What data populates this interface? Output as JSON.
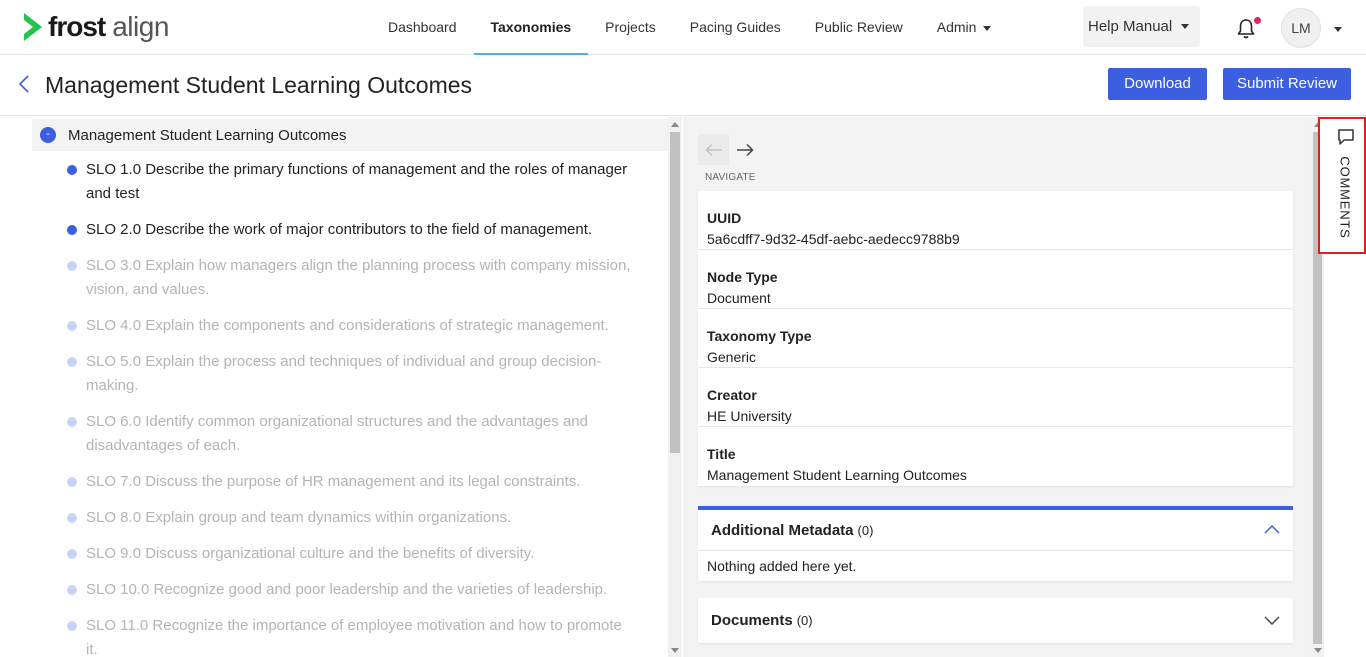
{
  "brand": {
    "word1": "frost",
    "word2": "align",
    "accent_color": "#24c34f"
  },
  "nav": {
    "items": [
      {
        "label": "Dashboard",
        "active": false
      },
      {
        "label": "Taxonomies",
        "active": true
      },
      {
        "label": "Projects",
        "active": false
      },
      {
        "label": "Pacing Guides",
        "active": false
      },
      {
        "label": "Public Review",
        "active": false
      },
      {
        "label": "Admin",
        "active": false,
        "dropdown": true
      }
    ]
  },
  "header": {
    "help_label": "Help Manual",
    "notification_icon": "bell-icon",
    "avatar_initials": "LM"
  },
  "page": {
    "title": "Management Student Learning Outcomes",
    "download_label": "Download",
    "submit_label": "Submit Review"
  },
  "tree": {
    "root_label": "Management Student Learning Outcomes",
    "collapse_symbol": "-",
    "items": [
      {
        "text": "SLO 1.0 Describe the primary functions of management and the roles of manager and test",
        "dim": false
      },
      {
        "text": "SLO 2.0 Describe the work of major contributors to the field of management.",
        "dim": false
      },
      {
        "text": "SLO 3.0 Explain how managers align the planning process with company mission, vision, and values.",
        "dim": true
      },
      {
        "text": "SLO 4.0 Explain the components and considerations of strategic management.",
        "dim": true
      },
      {
        "text": "SLO 5.0 Explain the process and techniques of individual and group decision-making.",
        "dim": true
      },
      {
        "text": "SLO 6.0 Identify common organizational structures and the advantages and disadvantages of each.",
        "dim": true
      },
      {
        "text": "SLO 7.0 Discuss the purpose of HR management and its legal constraints.",
        "dim": true
      },
      {
        "text": "SLO 8.0 Explain group and team dynamics within organizations.",
        "dim": true
      },
      {
        "text": "SLO 9.0 Discuss organizational culture and the benefits of diversity.",
        "dim": true
      },
      {
        "text": "SLO 10.0 Recognize good and poor leadership and the varieties of leadership.",
        "dim": true
      },
      {
        "text": "SLO 11.0 Recognize the importance of employee motivation and how to promote it.",
        "dim": true
      }
    ]
  },
  "details": {
    "navigate_label": "NAVIGATE",
    "rows": [
      {
        "key": "UUID",
        "value": "5a6cdff7-9d32-45df-aebc-aedecc9788b9"
      },
      {
        "key": "Node Type",
        "value": "Document"
      },
      {
        "key": "Taxonomy Type",
        "value": "Generic"
      },
      {
        "key": "Creator",
        "value": "HE University"
      },
      {
        "key": "Title",
        "value": "Management Student Learning Outcomes"
      }
    ],
    "additional": {
      "title": "Additional Metadata",
      "count": "(0)",
      "empty": "Nothing added here yet."
    },
    "documents": {
      "title": "Documents",
      "count": "(0)"
    }
  },
  "comments": {
    "label": "COMMENTS"
  }
}
